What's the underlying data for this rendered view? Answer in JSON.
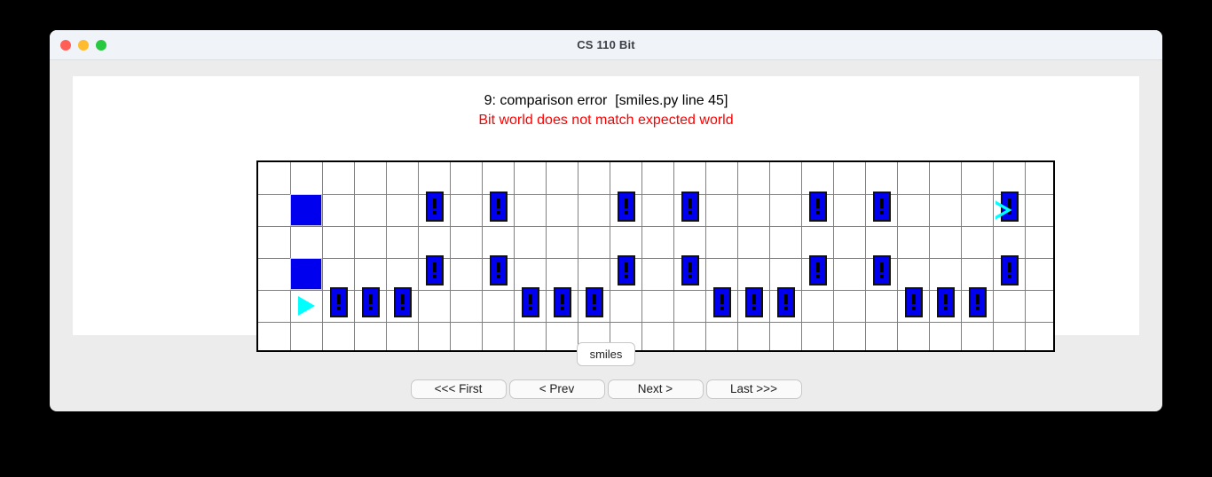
{
  "window": {
    "title": "CS 110 Bit",
    "traffic_lights": [
      {
        "name": "close",
        "color": "#ff5f57"
      },
      {
        "name": "minimize",
        "color": "#febc2e"
      },
      {
        "name": "zoom",
        "color": "#28c840"
      }
    ]
  },
  "message": {
    "line1": "9: comparison error  [smiles.py line 45]",
    "line2": "Bit world does not match expected world",
    "line1_color": "#000000",
    "line2_color": "#ff0000"
  },
  "grid": {
    "columns": 25,
    "rows": 6,
    "cell_size": 36,
    "line_color": "#808080",
    "border_color": "#000000",
    "paint_color": "#0000ee",
    "bit_color": "#00ffff",
    "objects": [
      {
        "kind": "paint",
        "col": 1,
        "row": 1
      },
      {
        "kind": "paint",
        "col": 1,
        "row": 3
      },
      {
        "kind": "bit",
        "col": 1,
        "row": 4,
        "state": "filled",
        "heading": "east"
      },
      {
        "kind": "bang",
        "col": 5,
        "row": 1
      },
      {
        "kind": "bang",
        "col": 7,
        "row": 1
      },
      {
        "kind": "bang",
        "col": 11,
        "row": 1
      },
      {
        "kind": "bang",
        "col": 13,
        "row": 1
      },
      {
        "kind": "bang",
        "col": 17,
        "row": 1
      },
      {
        "kind": "bang",
        "col": 19,
        "row": 1
      },
      {
        "kind": "bang",
        "col": 23,
        "row": 1
      },
      {
        "kind": "bit",
        "col": 23,
        "row": 1,
        "state": "hollow",
        "heading": "east"
      },
      {
        "kind": "bang",
        "col": 5,
        "row": 3
      },
      {
        "kind": "bang",
        "col": 7,
        "row": 3
      },
      {
        "kind": "bang",
        "col": 11,
        "row": 3
      },
      {
        "kind": "bang",
        "col": 13,
        "row": 3
      },
      {
        "kind": "bang",
        "col": 17,
        "row": 3
      },
      {
        "kind": "bang",
        "col": 19,
        "row": 3
      },
      {
        "kind": "bang",
        "col": 23,
        "row": 3
      },
      {
        "kind": "bang",
        "col": 2,
        "row": 4
      },
      {
        "kind": "bang",
        "col": 3,
        "row": 4
      },
      {
        "kind": "bang",
        "col": 4,
        "row": 4
      },
      {
        "kind": "bang",
        "col": 8,
        "row": 4
      },
      {
        "kind": "bang",
        "col": 9,
        "row": 4
      },
      {
        "kind": "bang",
        "col": 10,
        "row": 4
      },
      {
        "kind": "bang",
        "col": 14,
        "row": 4
      },
      {
        "kind": "bang",
        "col": 15,
        "row": 4
      },
      {
        "kind": "bang",
        "col": 16,
        "row": 4
      },
      {
        "kind": "bang",
        "col": 20,
        "row": 4
      },
      {
        "kind": "bang",
        "col": 21,
        "row": 4
      },
      {
        "kind": "bang",
        "col": 22,
        "row": 4
      }
    ]
  },
  "tabs": [
    {
      "label": "smiles",
      "selected": true
    }
  ],
  "nav_buttons": [
    {
      "label": "<<< First"
    },
    {
      "label": "< Prev"
    },
    {
      "label": "Next >"
    },
    {
      "label": "Last >>>"
    }
  ]
}
